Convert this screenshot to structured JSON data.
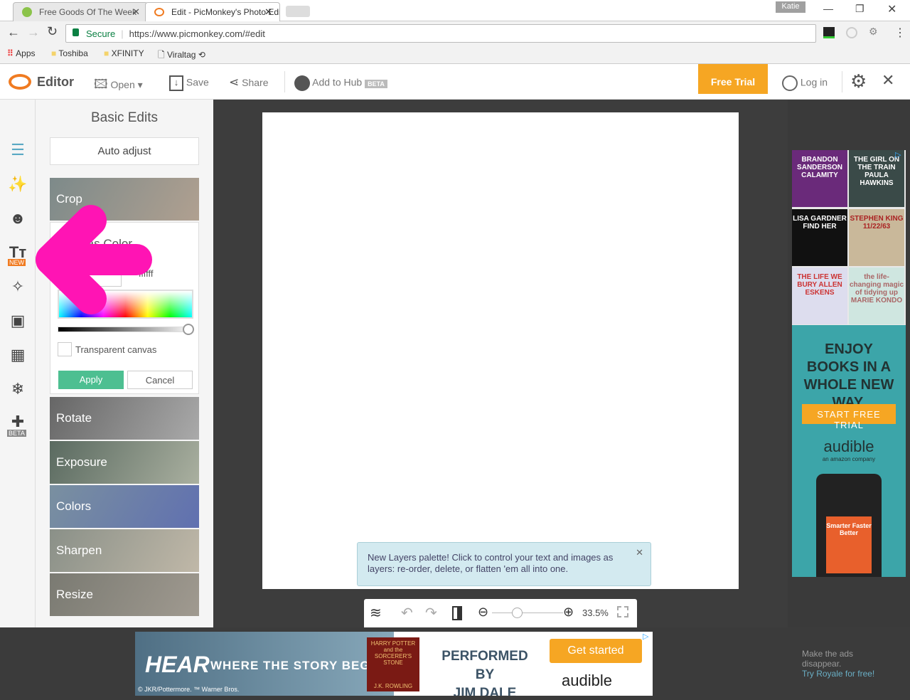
{
  "browser": {
    "tabs": [
      {
        "title": "Free Goods Of The Week"
      },
      {
        "title": "Edit - PicMonkey's Photo Editor"
      }
    ],
    "profile": "Katie",
    "secure_label": "Secure",
    "url": "https://www.picmonkey.com/#edit",
    "bookmarks": [
      "Apps",
      "Toshiba",
      "XFINITY",
      "Viraltag"
    ]
  },
  "header": {
    "logo": "Editor",
    "open": "Open",
    "save": "Save",
    "share": "Share",
    "add_to_hub": "Add to Hub",
    "beta": "BETA",
    "free_trial": "Free Trial",
    "login": "Log in"
  },
  "sidebar": {
    "icons": [
      "sliders-icon",
      "magic-wand-icon",
      "face-icon",
      "text-icon",
      "butterfly-icon",
      "frame-icon",
      "texture-icon",
      "snowflake-icon",
      "collage-icon"
    ],
    "new_badge": "NEW",
    "beta_badge": "BETA"
  },
  "panel": {
    "title": "Basic Edits",
    "auto_adjust": "Auto adjust",
    "tiles": [
      "Crop",
      "Rotate",
      "Exposure",
      "Colors",
      "Sharpen",
      "Resize"
    ],
    "canvas_color": {
      "title": "Canvas Color",
      "hex": "ffffff",
      "brightness": 1.0,
      "transparent_label": "Transparent canvas",
      "transparent_checked": false,
      "apply": "Apply",
      "cancel": "Cancel"
    }
  },
  "tooltip": {
    "text": "New Layers palette! Click to control your text and images as layers: re-order, delete, or flatten 'em all into one."
  },
  "toolbar": {
    "zoom": "33.5%",
    "zoom_fraction": 0.35
  },
  "right_ad": {
    "books": [
      "BRANDON SANDERSON CALAMITY",
      "THE GIRL ON THE TRAIN PAULA HAWKINS",
      "LISA GARDNER FIND HER",
      "STEPHEN KING 11/22/63",
      "THE LIFE WE BURY ALLEN ESKENS",
      "the life-changing magic of tidying up MARIE KONDO"
    ],
    "headline": "ENJOY BOOKS IN A WHOLE NEW WAY.",
    "cta": "START FREE TRIAL",
    "brand": "audible",
    "brand_sub": "an amazon company",
    "phone_text": "Smarter Faster Better"
  },
  "bottom_ad": {
    "hear": "HEAR",
    "tagline": "WHERE THE STORY BEGINS",
    "copyright": "© JKR/Pottermore. ™ Warner Bros.",
    "book": "HARRY POTTER and the SORCERER'S STONE",
    "author": "J.K. ROWLING",
    "performed": "PERFORMED BY",
    "narrator": "JIM DALE",
    "cta": "Get started",
    "brand": "audible"
  },
  "royale": {
    "line1": "Make the ads disappear.",
    "link": "Try Royale for free!"
  },
  "colors": {
    "accent": "#f6a623",
    "apply": "#4dbf91",
    "arrow": "#ff14b4",
    "tooltip": "#d3eaf0"
  }
}
